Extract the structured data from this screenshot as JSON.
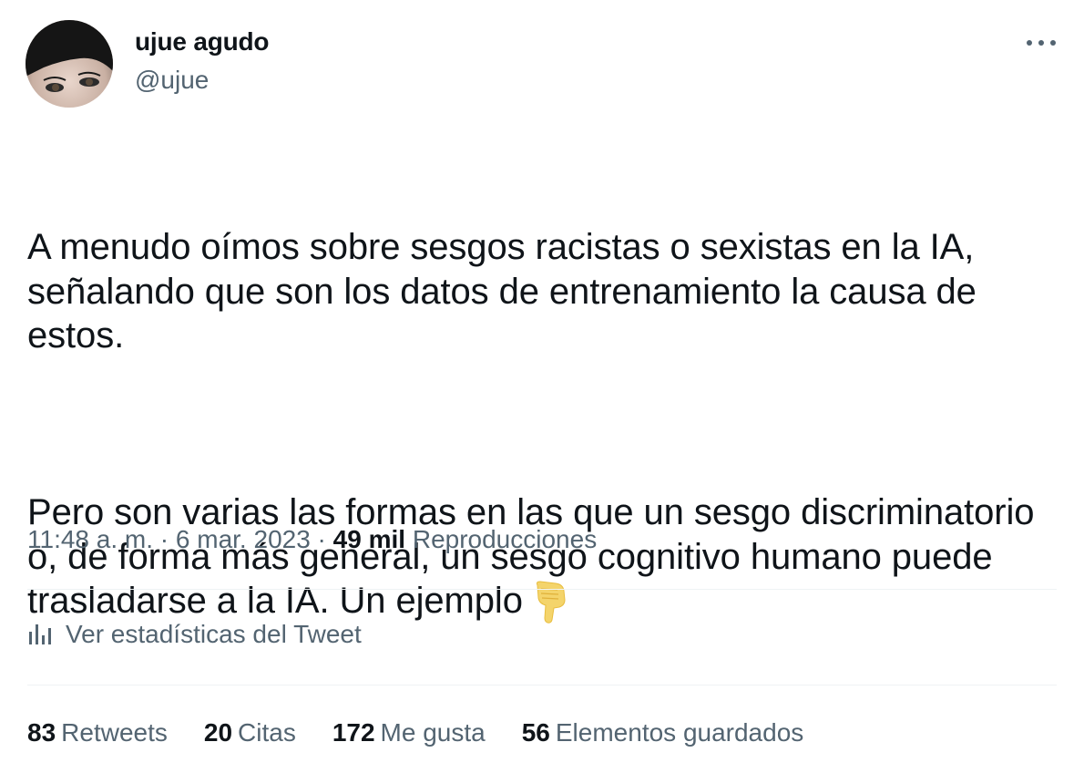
{
  "author": {
    "display_name": "ujue agudo",
    "handle": "@ujue"
  },
  "tweet": {
    "paragraph_1": "A menudo oímos sobre sesgos racistas o sexistas en la IA, señalando que son los datos de entrenamiento la causa de estos.",
    "paragraph_2": "Pero son varias las formas en las que un sesgo discriminatorio o, de forma más general, un sesgo cognitivo humano puede trasladarse a la IA. Un ejemplo",
    "emoji_icon": "pointing-down-hand-icon"
  },
  "meta": {
    "time": "11:48 a. m.",
    "separator": " · ",
    "date": "6 mar. 2023",
    "views_count": "49 mil",
    "views_label": "Reproducciones"
  },
  "stats_link": {
    "label": "Ver estadísticas del Tweet",
    "icon": "bar-chart-icon"
  },
  "counts": [
    {
      "num": "83",
      "label": "Retweets"
    },
    {
      "num": "20",
      "label": "Citas"
    },
    {
      "num": "172",
      "label": "Me gusta"
    },
    {
      "num": "56",
      "label": "Elementos guardados"
    }
  ],
  "colors": {
    "text_primary": "#0f1419",
    "text_secondary": "#536471",
    "divider": "#eff3f4",
    "emoji": "#f4d46b"
  }
}
